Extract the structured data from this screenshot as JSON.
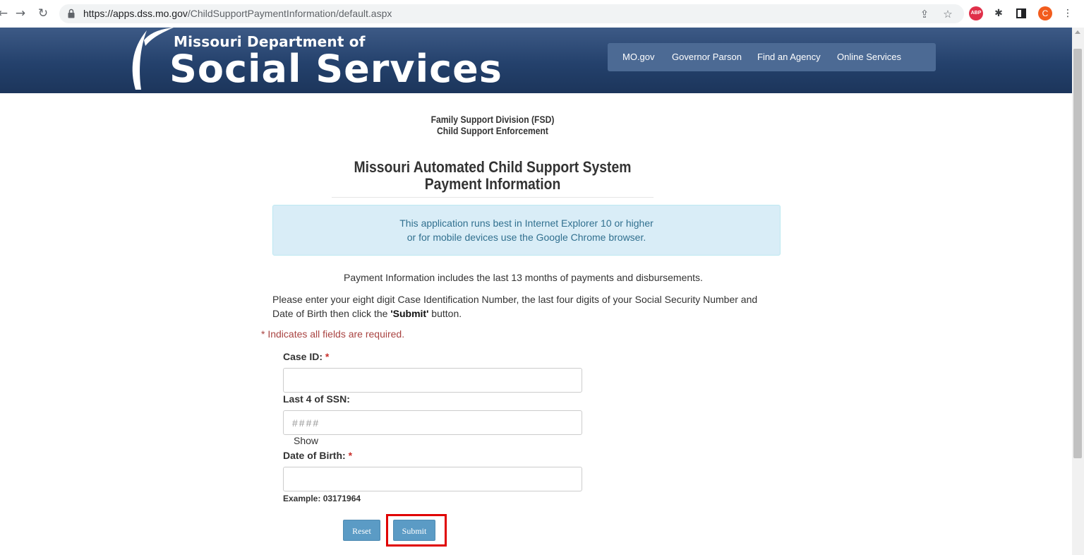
{
  "browser": {
    "url_host": "https://apps.dss.mo.gov",
    "url_path": "/ChildSupportPaymentInformation/default.aspx",
    "abp_label": "ABP",
    "avatar_letter": "C"
  },
  "header": {
    "logo_top": "Missouri Department of",
    "logo_main": "Social Services",
    "nav": [
      {
        "label": "MO.gov"
      },
      {
        "label": "Governor Parson"
      },
      {
        "label": "Find an Agency"
      },
      {
        "label": "Online Services"
      }
    ]
  },
  "main": {
    "division_line1": "Family Support Division (FSD)",
    "division_line2": "Child Support Enforcement",
    "title_line1": "Missouri Automated Child Support System",
    "title_line2": "Payment Information",
    "info_line1": "This application runs best in Internet Explorer 10 or higher",
    "info_line2": "or for mobile devices use the Google Chrome browser.",
    "payment_note": "Payment Information includes the last 13 months of payments and disbursements.",
    "instructions_line1": "Please enter your eight digit Case Identification Number, the last four digits of your Social Security Number and",
    "instructions_line2_pre": "Date of Birth then click the ",
    "instructions_bold": "'Submit'",
    "instructions_line2_post": " button.",
    "required_note": "* Indicates all fields are required."
  },
  "form": {
    "case_id_label": "Case ID:",
    "ssn_label": "Last 4 of SSN:",
    "ssn_placeholder": "####",
    "show_label": "Show",
    "dob_label": "Date of Birth:",
    "required_mark": "*",
    "dob_example": "Example: 03171964",
    "reset_label": "Reset",
    "submit_label": "Submit"
  },
  "colors": {
    "header_bg": "#24416c",
    "nav_bg": "#4c6a94",
    "info_bg": "#d9edf7",
    "info_text": "#31708f",
    "button_bg": "#5b9bc5",
    "required": "#a94442",
    "highlight": "#e00000"
  }
}
